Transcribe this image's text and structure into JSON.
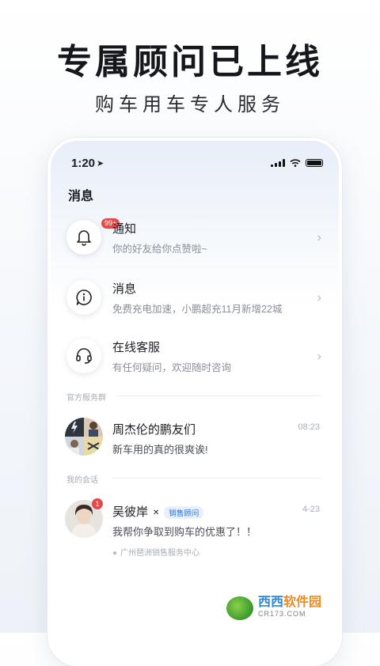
{
  "hero": {
    "title": "专属顾问已上线",
    "subtitle": "购车用车专人服务"
  },
  "status_bar": {
    "time": "1:20"
  },
  "page": {
    "title": "消息"
  },
  "rows": [
    {
      "title": "通知",
      "subtitle": "你的好友给你点赞啦~",
      "icon": "bell-icon",
      "badge": "99+"
    },
    {
      "title": "消息",
      "subtitle": "免费充电加速，小鹏超充11月新增22城",
      "icon": "info-icon"
    },
    {
      "title": "在线客服",
      "subtitle": "有任何疑问，欢迎随时咨询",
      "icon": "headset-icon"
    }
  ],
  "sections": {
    "official": "官方服务群",
    "my_chats": "我的会话"
  },
  "group_chat": {
    "name": "周杰伦的鹏友们",
    "time": "08:23",
    "message": "新车用的真的很爽诶!"
  },
  "advisor_chat": {
    "name": "吴彼岸",
    "role": "销售顾问",
    "time": "4-23",
    "message": "我帮你争取到购车的优惠了！！",
    "location": "广州琶洲销售服务中心",
    "unread": "1"
  },
  "watermark": {
    "brand_part1": "西西",
    "brand_part2": "软件园",
    "domain": "CR173.COM"
  },
  "colors": {
    "accent": "#2b6fd6",
    "badge_red": "#e24b4b"
  }
}
